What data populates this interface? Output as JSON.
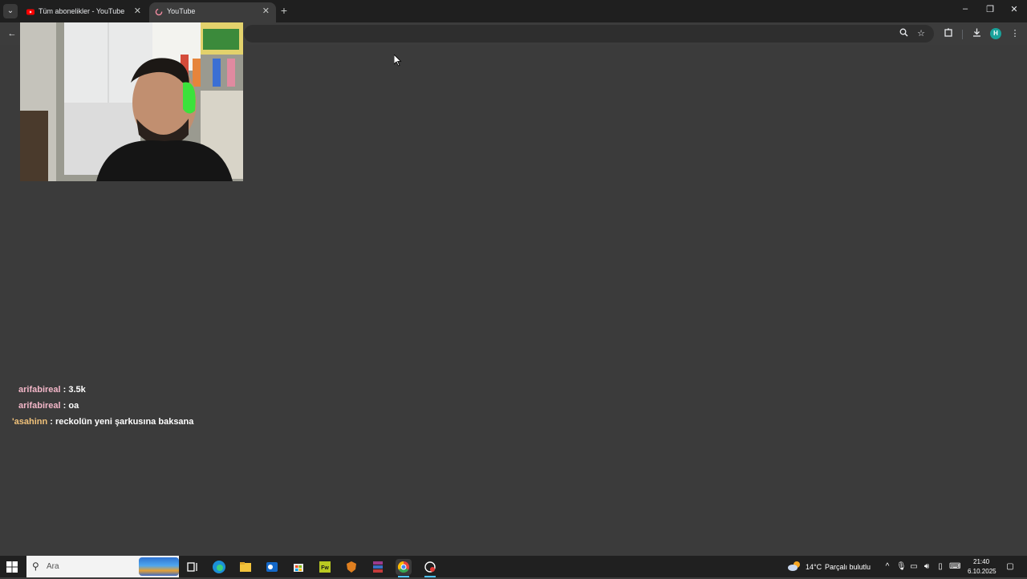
{
  "browser": {
    "tabs": [
      {
        "title": "Tüm abonelikler - YouTube",
        "active": false
      },
      {
        "title": "YouTube",
        "active": true
      }
    ],
    "new_tab_icon": "plus-icon",
    "window_controls": [
      "minimize-icon",
      "restore-icon",
      "close-icon"
    ]
  },
  "toolbar": {
    "icons": [
      "back-arrow-icon",
      "zoom-icon",
      "bookmark-star-icon",
      "extensions-icon",
      "download-icon",
      "profile-avatar",
      "menu-icon"
    ],
    "profile_initial": "H"
  },
  "chat": {
    "messages": [
      {
        "user": "arifabireal",
        "sep": " : ",
        "text": "3.5k"
      },
      {
        "user": "arifabireal",
        "sep": " : ",
        "text": "oa"
      },
      {
        "user": "'asahinn",
        "sep": " : ",
        "text": "reckolün yeni şarkusına baksana"
      }
    ]
  },
  "taskbar": {
    "search_placeholder": "Ara",
    "apps": [
      "task-view-icon",
      "edge-icon",
      "file-explorer-icon",
      "outlook-icon",
      "store-icon",
      "fw-icon",
      "shield-app-icon",
      "winrar-icon",
      "chrome-icon",
      "recorder-icon"
    ],
    "weather": {
      "temp": "14°C",
      "condition": "Parçalı bulutlu"
    },
    "time": "21:40",
    "date": "6.10.2025"
  },
  "colors": {
    "page_bg": "#3b3b3b",
    "tabstrip_bg": "#1f1f1f",
    "taskbar_bg": "#202020",
    "chat_user_pink": "#f3b7c8",
    "chat_user_gold": "#f1c27a"
  }
}
